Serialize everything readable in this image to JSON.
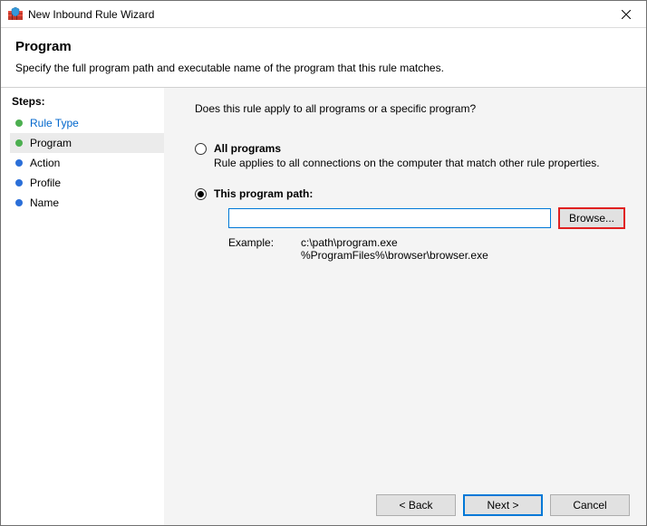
{
  "window": {
    "title": "New Inbound Rule Wizard"
  },
  "header": {
    "title": "Program",
    "subtitle": "Specify the full program path and executable name of the program that this rule matches."
  },
  "sidebar": {
    "title": "Steps:",
    "items": [
      {
        "label": "Rule Type"
      },
      {
        "label": "Program"
      },
      {
        "label": "Action"
      },
      {
        "label": "Profile"
      },
      {
        "label": "Name"
      }
    ]
  },
  "main": {
    "question": "Does this rule apply to all programs or a specific program?",
    "option_all": {
      "label": "All programs",
      "desc": "Rule applies to all connections on the computer that match other rule properties."
    },
    "option_path": {
      "label": "This program path:",
      "value": "",
      "browse": "Browse...",
      "example_label": "Example:",
      "example_text": "c:\\path\\program.exe\n%ProgramFiles%\\browser\\browser.exe"
    }
  },
  "footer": {
    "back": "< Back",
    "next": "Next >",
    "cancel": "Cancel"
  }
}
